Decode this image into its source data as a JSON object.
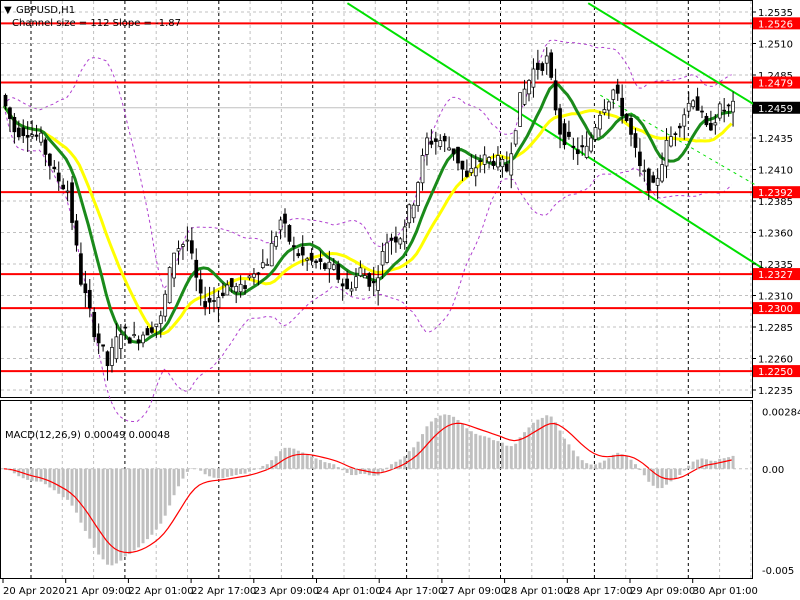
{
  "header": {
    "symbol": "GBPUSD,H1",
    "channel_info": "Channel size = 112 Slope = -1.87"
  },
  "macd": {
    "label": "MACD(12,26,9) 0.00049 0.00048",
    "scale_ticks": [
      "0.00284",
      "0.00",
      "-0.005"
    ]
  },
  "colors": {
    "level_line": "#ff0000",
    "channel": "#00e000",
    "ma_fast": "#1a8a1a",
    "ma_slow": "#ffff00",
    "bollinger": "#b040d0",
    "macd_hist": "#c0c0c0",
    "macd_signal": "#ff0000",
    "current_price_bg": "#000000"
  },
  "chart_data": {
    "type": "candlestick",
    "title": "GBPUSD,H1",
    "ylim": [
      1.2225,
      1.2545
    ],
    "price_ticks": [
      "1.2535",
      "1.2510",
      "1.2485",
      "1.2435",
      "1.2410",
      "1.2385",
      "1.2360",
      "1.2335",
      "1.2310",
      "1.2285",
      "1.2260",
      "1.2235"
    ],
    "levels": [
      "1.2526",
      "1.2479",
      "1.2392",
      "1.2327",
      "1.2300",
      "1.2250"
    ],
    "current_price": "1.2459",
    "x_labels": [
      "20 Apr 2020",
      "21 Apr 09:00",
      "22 Apr 01:00",
      "22 Apr 17:00",
      "23 Apr 09:00",
      "24 Apr 01:00",
      "24 Apr 17:00",
      "27 Apr 09:00",
      "28 Apr 01:00",
      "28 Apr 17:00",
      "29 Apr 09:00",
      "30 Apr 01:00"
    ],
    "closes": [
      1.2469,
      1.2441,
      1.2441,
      1.2433,
      1.2406,
      1.2394,
      1.2322,
      1.2283,
      1.2255,
      1.2283,
      1.2275,
      1.2283,
      1.2291,
      1.2346,
      1.2354,
      1.2306,
      1.2306,
      1.2318,
      1.2314,
      1.233,
      1.2338,
      1.237,
      1.2346,
      1.2338,
      1.2334,
      1.233,
      1.2314,
      1.233,
      1.2318,
      1.2354,
      1.2358,
      1.2386,
      1.2433,
      1.2433,
      1.2425,
      1.2402,
      1.2418,
      1.2418,
      1.241,
      1.2465,
      1.2489,
      1.2497,
      1.2441,
      1.2425,
      1.2425,
      1.2457,
      1.2473,
      1.2449,
      1.241,
      1.2394,
      1.2429,
      1.2449,
      1.2469,
      1.2441,
      1.2457,
      1.2459
    ],
    "channel_lines": [
      {
        "style": "solid",
        "from": [
          28.3,
          1.2542
        ],
        "to": [
          62.7,
          1.2331
        ]
      },
      {
        "style": "solid",
        "from": [
          48.2,
          1.2542
        ],
        "to": [
          62.7,
          1.2457
        ]
      },
      {
        "style": "dotted",
        "from": [
          49.2,
          1.2469
        ],
        "to": [
          62.7,
          1.2394
        ]
      }
    ],
    "macd_ylim": [
      -0.0053,
      0.0032
    ]
  }
}
